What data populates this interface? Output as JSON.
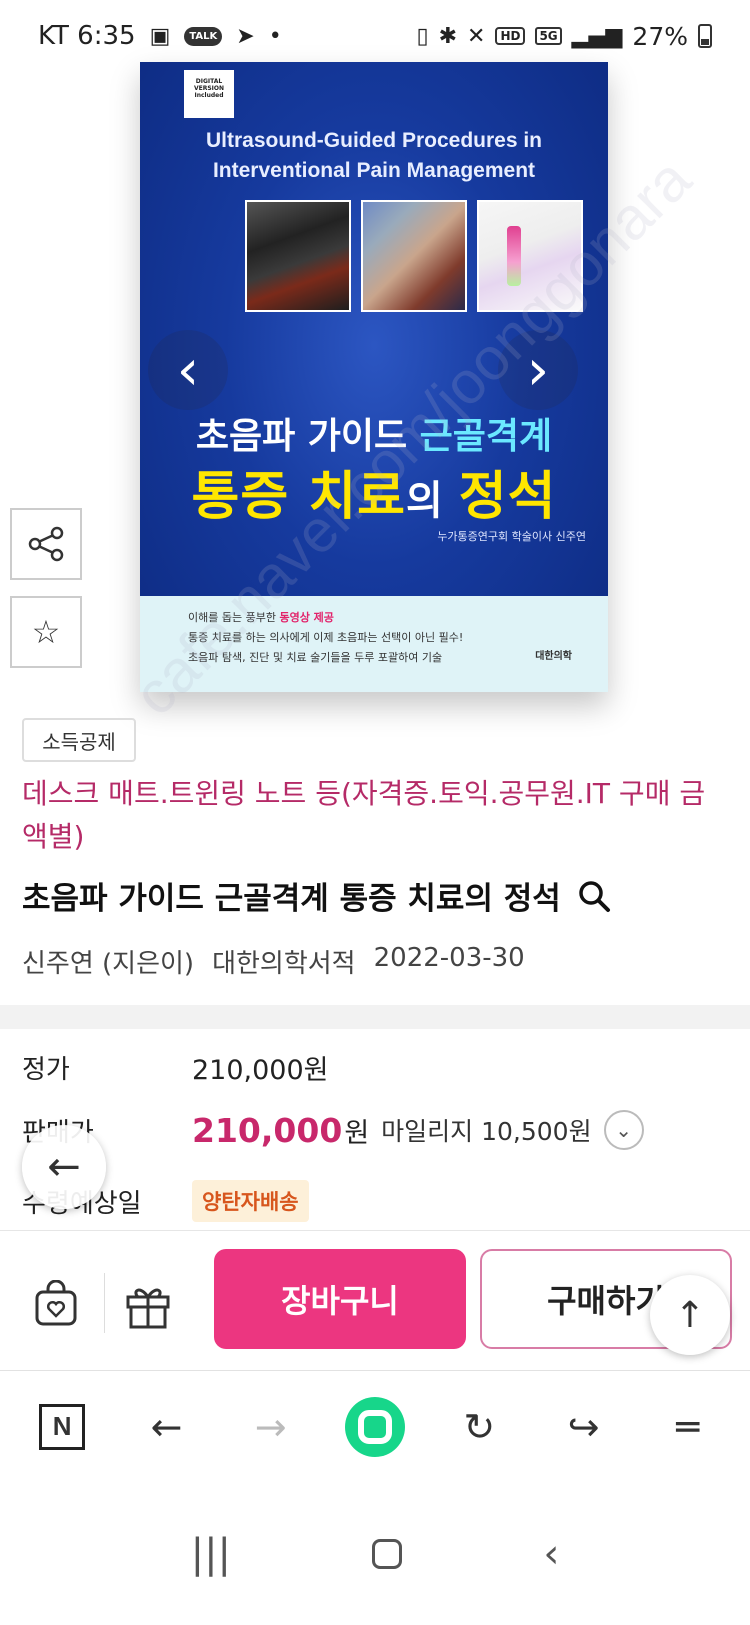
{
  "status_bar": {
    "carrier_time": "KT 6:35",
    "talk_badge": "TALK",
    "hd_label": "HD",
    "network_label": "5G",
    "battery": "27%"
  },
  "cover": {
    "digital_badge": "DIGITAL VERSION Included",
    "title_en_line1": "Ultrasound-Guided Procedures in",
    "title_en_line2": "Interventional Pain Management",
    "title_ko_line1_a": "초음파 가이드 ",
    "title_ko_line1_b": "근골격계",
    "title_ko_line2_a": "통증 치료",
    "title_ko_line2_b": "의 ",
    "title_ko_line2_c": "정석",
    "author_line": "누가통증연구회 학술이사 신주연",
    "bottom_line1_a": "이해를 돕는 풍부한 ",
    "bottom_line1_b": "동영상 제공",
    "bottom_line2": "통증 치료를 하는 의사에게 이제 초음파는 선택이 아닌 필수!",
    "bottom_line3": "초음파 탐색, 진단 및 치료 술기들을 두루 포괄하여 기술",
    "publisher_logo": "대한의학"
  },
  "carousel": {
    "prev_glyph": "‹",
    "next_glyph": "›"
  },
  "watermark": "cafe.naver.com/joonggonara",
  "product": {
    "tag_chip": "소득공제",
    "promo_text": "데스크 매트.트윈링 노트 등(자격증.토익.공무원.IT 구매 금액별)",
    "title": "초음파 가이드 근골격계 통증 치료의 정석",
    "author": "신주연 (지은이)",
    "publisher": "대한의학서적",
    "pub_date": "2022-03-30"
  },
  "price": {
    "list_label": "정가",
    "list_value": "210,000원",
    "sale_label": "판매가",
    "sale_value": "210,000",
    "sale_unit": "원",
    "mileage": "마일리지 10,500원",
    "ship_label": "수령예상일",
    "ship_badge": "양탄자배송"
  },
  "purchase_bar": {
    "cart_label": "장바구니",
    "buy_label": "구매하기"
  },
  "colors": {
    "accent_pink": "#ec3680",
    "price_pink": "#c8286b",
    "promo_text": "#b52a67",
    "ship_badge_text": "#d7561d",
    "browser_green": "#17d68a"
  },
  "icons": {
    "share": "share-icon",
    "favorite": "star-icon",
    "search": "search-icon",
    "back": "arrow-left-icon",
    "scroll_top": "arrow-up-icon",
    "wishlist": "heart-bag-icon",
    "gift": "gift-icon"
  }
}
